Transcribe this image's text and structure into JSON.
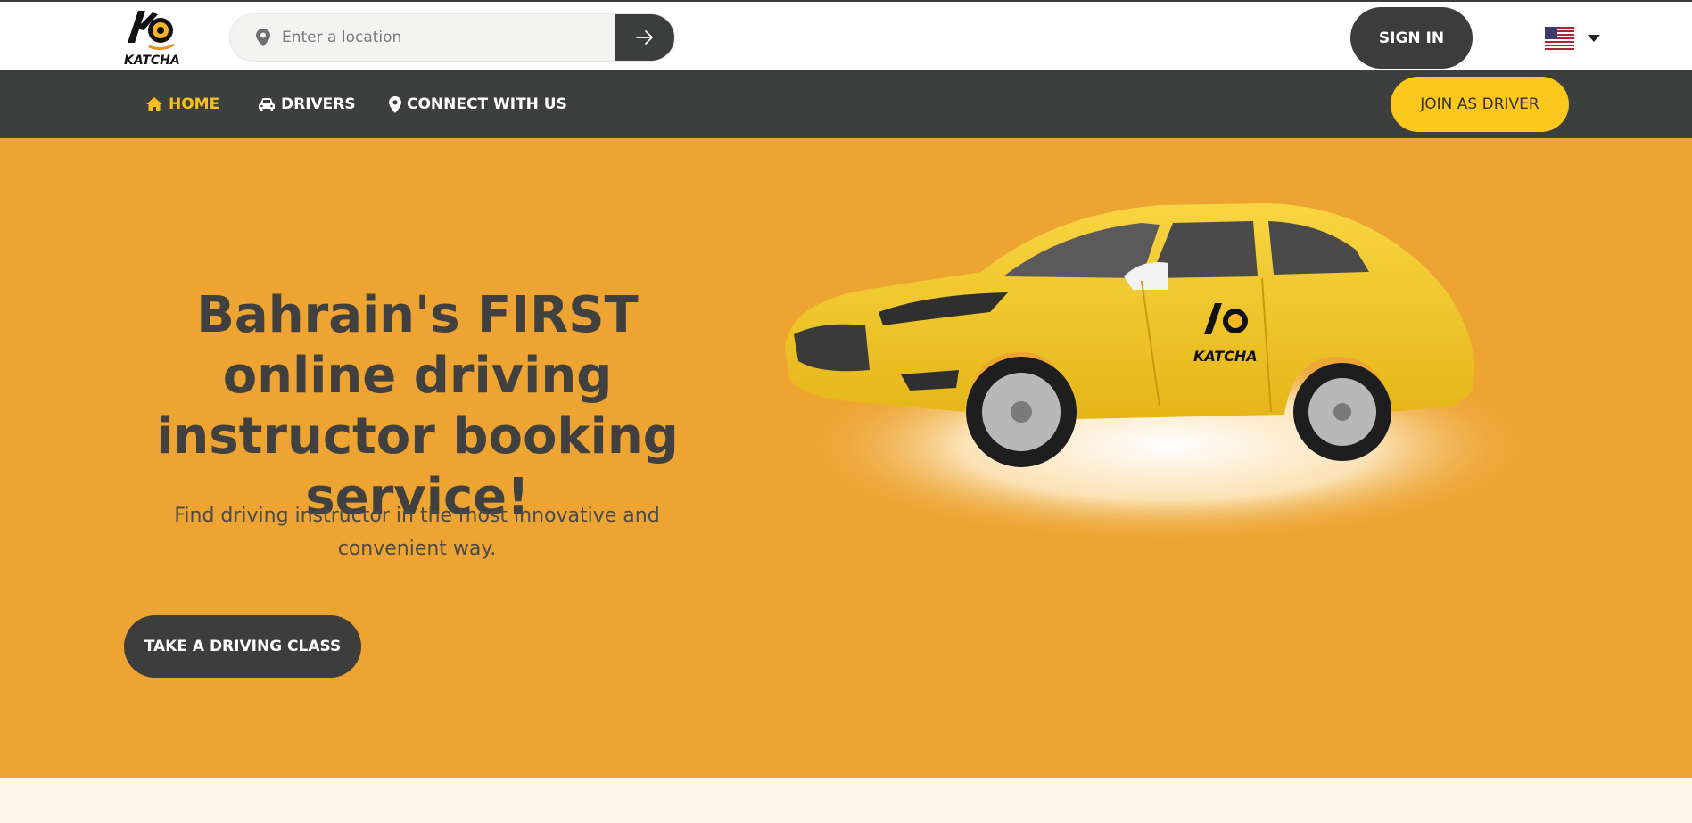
{
  "header": {
    "logo_text": "KATCHA",
    "search": {
      "placeholder": "Enter a location"
    },
    "sign_in_label": "SIGN IN",
    "language": "en-US"
  },
  "nav": {
    "items": [
      {
        "label": "HOME",
        "icon": "home-icon",
        "active": true
      },
      {
        "label": "DRIVERS",
        "icon": "car-icon",
        "active": false
      },
      {
        "label": "CONNECT WITH US",
        "icon": "map-pin-icon",
        "active": false
      }
    ],
    "join_label": "JOIN AS DRIVER"
  },
  "hero": {
    "headline": "Bahrain's FIRST online driving instructor booking service!",
    "subtext": "Find driving instructor in the most innovative and convenient way.",
    "cta_label": "TAKE A DRIVING CLASS",
    "car_logo_text": "KATCHA"
  },
  "colors": {
    "hero_bg": "#eda432",
    "nav_bg": "#3d3e3e",
    "accent_yellow": "#fcc81e",
    "active_nav": "#f6bf1f",
    "dark_button": "#3c3c3c"
  }
}
